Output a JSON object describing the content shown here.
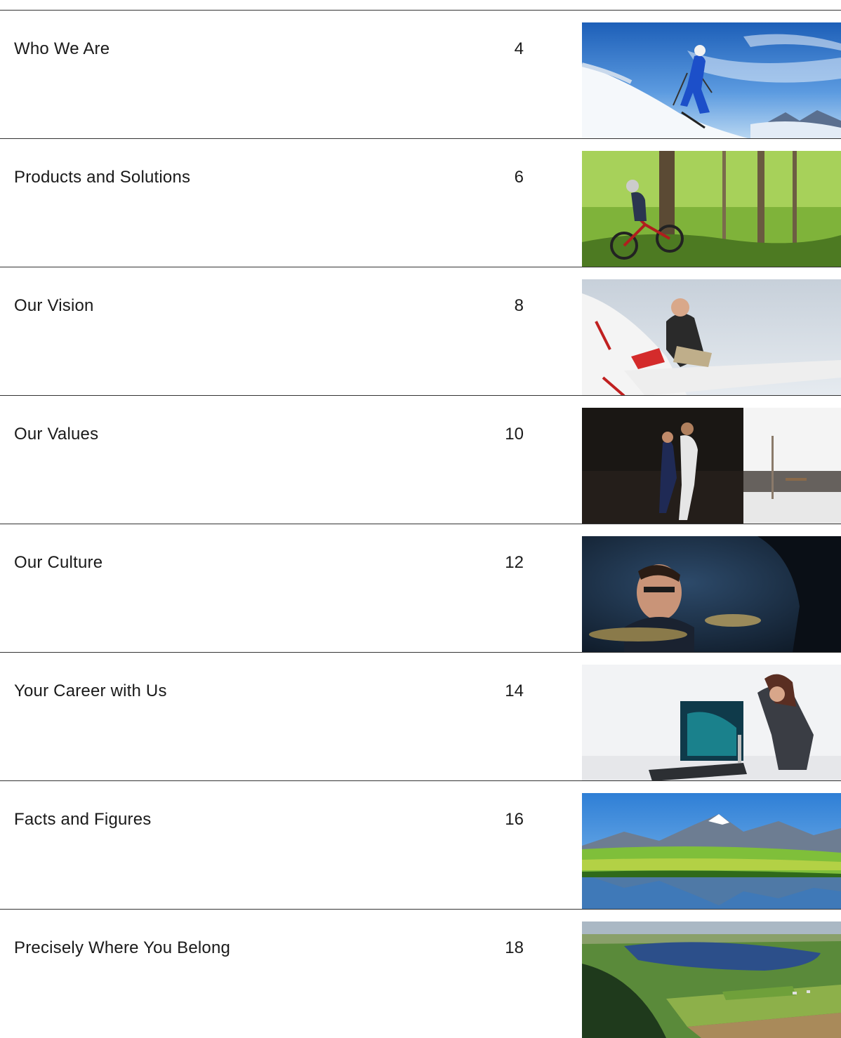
{
  "toc": {
    "entries": [
      {
        "title": "Who We Are",
        "page": "4",
        "image": "skier-on-snowy-slope"
      },
      {
        "title": "Products and Solutions",
        "page": "6",
        "image": "mountain-biker-in-forest"
      },
      {
        "title": "Our Vision",
        "page": "8",
        "image": "pilot-on-swiss-airplane-wing"
      },
      {
        "title": "Our Values",
        "page": "10",
        "image": "couple-dancing-in-lab"
      },
      {
        "title": "Our Culture",
        "page": "12",
        "image": "drummer-playing-cymbals"
      },
      {
        "title": "Your Career with Us",
        "page": "14",
        "image": "artist-painting-on-floor"
      },
      {
        "title": "Facts and Figures",
        "page": "16",
        "image": "alpine-lake-reflection"
      },
      {
        "title": "Precisely Where You Belong",
        "page": "18",
        "image": "aerial-lake-landscape"
      }
    ]
  }
}
